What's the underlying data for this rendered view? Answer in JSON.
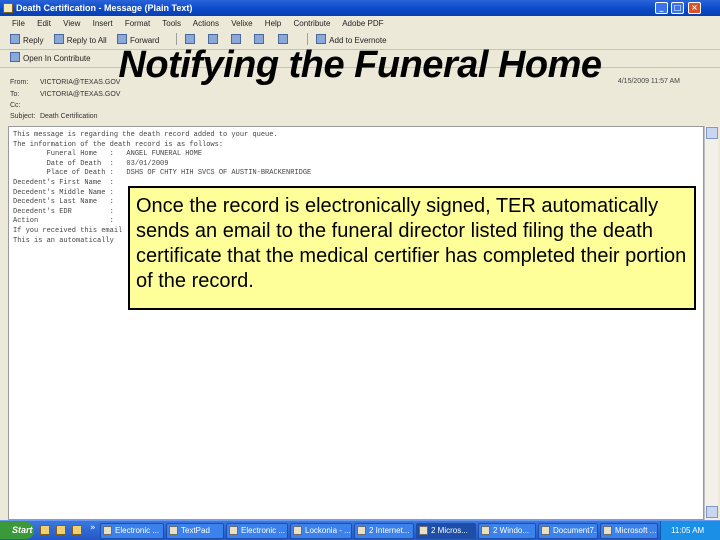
{
  "window": {
    "title": "Death Certification - Message (Plain Text)"
  },
  "menu": {
    "items": [
      "File",
      "Edit",
      "View",
      "Insert",
      "Format",
      "Tools",
      "Actions",
      "Velixe",
      "Help",
      "Contribute",
      "Adobe PDF"
    ]
  },
  "toolbar1": {
    "reply": "Reply",
    "reply_all": "Reply to All",
    "forward": "Forward",
    "add_to_evernote": "Add to Evernote"
  },
  "toolbar2": {
    "open_in_contribute": "Open In Contribute"
  },
  "headers": {
    "from_label": "From:",
    "from_value": "VICTORIA@TEXAS.GOV",
    "to_label": "To:",
    "to_value": "VICTORIA@TEXAS.GOV",
    "cc_label": "Cc:",
    "subject_label": "Subject:",
    "subject_value": "Death Certification",
    "sent": "4/15/2009 11:57 AM"
  },
  "slide": {
    "title": "Notifying the Funeral Home",
    "callout": "Once the record is electronically signed, TER automatically sends an email to the funeral director listed filing the death certificate that the medical certifier has completed their portion of the record."
  },
  "message": {
    "lines": [
      "This message is regarding the death record added to your queue.",
      "The information of the death record is as follows:",
      "        Funeral Home   :   ANGEL FUNERAL HOME",
      "        Date of Death  :   03/01/2009",
      "        Place of Death :   DSHS OF CHTY HIH SVCS OF AUSTIN-BRACKENRIDGE",
      "Decedent's First Name  :",
      "Decedent's Middle Name :",
      "Decedent's Last Name   :",
      "Decedent's EDR         :",
      "Action                 :",
      "If you received this email",
      "This is an automatically"
    ]
  },
  "taskbar": {
    "start": "Start",
    "tasks": [
      "Electronic ...",
      "TextPad",
      "Electronic ...",
      "Lockonia - ...",
      "2 Internet...",
      "2 Micros...",
      "2 Windo...",
      "Document7...",
      "Microsoft ..."
    ],
    "clock": "11:05 AM"
  }
}
